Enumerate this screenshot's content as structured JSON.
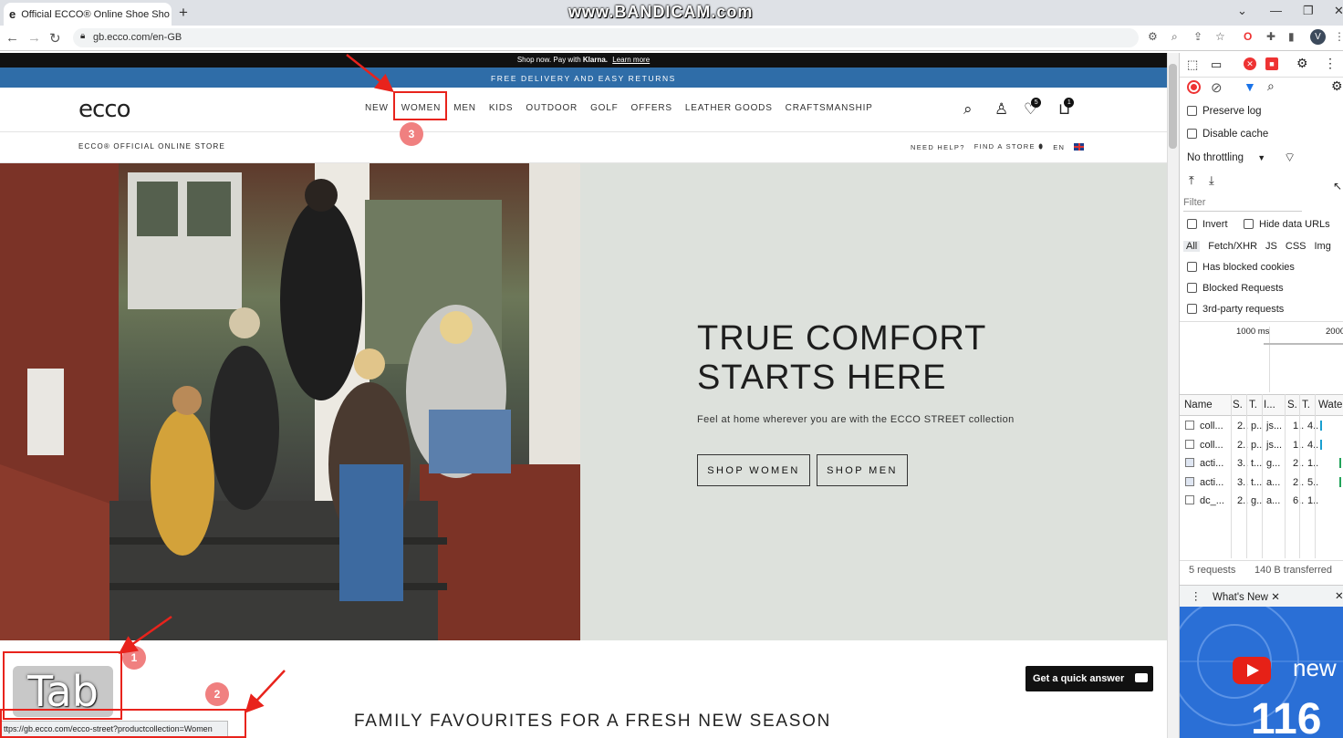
{
  "browser": {
    "tab_title": "Official ECCO® Online Shoe Sho",
    "watermark": "www.BANDICAM.com",
    "url": "gb.ecco.com/en-GB",
    "status_url": "ttps://gb.ecco.com/ecco-street?productcollection=Women",
    "profile_initial": "V"
  },
  "site": {
    "promo_text": "Shop now. Pay with",
    "promo_brand": "Klarna.",
    "promo_link": "Learn more",
    "delivery_banner": "FREE DELIVERY AND EASY RETURNS",
    "logo": "ecco",
    "nav": [
      "NEW",
      "WOMEN",
      "MEN",
      "KIDS",
      "OUTDOOR",
      "GOLF",
      "OFFERS",
      "LEATHER GOODS",
      "CRAFTSMANSHIP"
    ],
    "wishlist_count": "5",
    "cart_count": "1",
    "store_label": "ECCO® OFFICIAL ONLINE STORE",
    "need_help": "NEED HELP?",
    "find_store": "FIND A STORE",
    "language": "EN",
    "hero_title_1": "TRUE COMFORT",
    "hero_title_2": "STARTS HERE",
    "hero_subtitle": "Feel at home wherever you are with the ECCO STREET collection",
    "btn_women": "SHOP WOMEN",
    "btn_men": "SHOP MEN",
    "quick_answer": "Get a quick answer",
    "section_title": "FAMILY FAVOURITES FOR A FRESH NEW SEASON"
  },
  "annotations": {
    "step1": "1",
    "step2": "2",
    "step3": "3",
    "key_label": "Tab",
    "accent_color": "#e8231c",
    "badge_color": "#f08080"
  },
  "devtools": {
    "preserve_log": "Preserve log",
    "disable_cache": "Disable cache",
    "throttling": "No throttling",
    "filter_placeholder": "Filter",
    "invert": "Invert",
    "hide_data_urls": "Hide data URLs",
    "types": [
      "All",
      "Fetch/XHR",
      "JS",
      "CSS",
      "Img"
    ],
    "has_blocked_cookies": "Has blocked cookies",
    "blocked_requests": "Blocked Requests",
    "third_party": "3rd-party requests",
    "timeline_labels": [
      "1000 ms",
      "2000"
    ],
    "columns": [
      "Name",
      "S.",
      "T.",
      "I...",
      "S.",
      "T.",
      "Water"
    ],
    "rows": [
      {
        "name": "coll...",
        "c1": "2..",
        "c2": "p..",
        "c3": "js...",
        "c4": "1..",
        "c5": "4.."
      },
      {
        "name": "coll...",
        "c1": "2..",
        "c2": "p..",
        "c3": "js...",
        "c4": "1..",
        "c5": "4.."
      },
      {
        "name": "acti...",
        "c1": "3..",
        "c2": "t...",
        "c3": "g...",
        "c4": "2..",
        "c5": "1.."
      },
      {
        "name": "acti...",
        "c1": "3..",
        "c2": "t...",
        "c3": "a...",
        "c4": "2..",
        "c5": "5.."
      },
      {
        "name": "dc_...",
        "c1": "2..",
        "c2": "g..",
        "c3": "a...",
        "c4": "6..",
        "c5": "1.."
      }
    ],
    "requests": "5 requests",
    "transferred": "140 B transferred",
    "whats_new": "What's New",
    "promo_new": "new",
    "promo_version": "116"
  }
}
